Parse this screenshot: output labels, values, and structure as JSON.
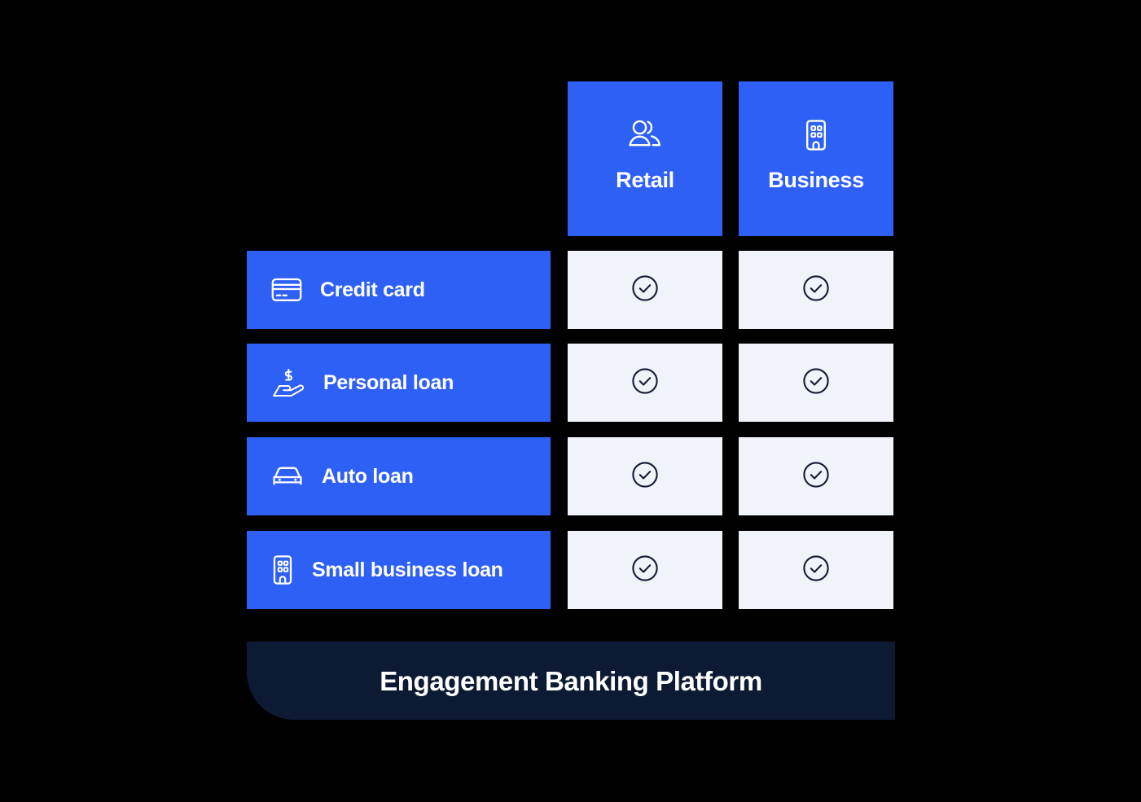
{
  "theme": {
    "background": "#000000",
    "accent_blue": "#2f60f5",
    "cell_light": "#f0f3fa",
    "footer_navy": "#0c1b33",
    "text_white": "#ffffff",
    "check_navy": "#131c34"
  },
  "matrix": {
    "columns": [
      {
        "label": "Retail",
        "icon": "users-icon"
      },
      {
        "label": "Business",
        "icon": "building-icon"
      }
    ],
    "rows": [
      {
        "label": "Credit card",
        "icon": "credit-card-icon",
        "cells": [
          {
            "state": "included",
            "icon": "check-circle-icon"
          },
          {
            "state": "included",
            "icon": "check-circle-icon"
          }
        ]
      },
      {
        "label": "Personal loan",
        "icon": "hand-dollar-icon",
        "cells": [
          {
            "state": "included",
            "icon": "check-circle-icon"
          },
          {
            "state": "included",
            "icon": "check-circle-icon"
          }
        ]
      },
      {
        "label": "Auto loan",
        "icon": "car-icon",
        "cells": [
          {
            "state": "included",
            "icon": "check-circle-icon"
          },
          {
            "state": "included",
            "icon": "check-circle-icon"
          }
        ]
      },
      {
        "label": "Small business loan",
        "icon": "building-icon",
        "cells": [
          {
            "state": "included",
            "icon": "check-circle-icon"
          },
          {
            "state": "included",
            "icon": "check-circle-icon"
          }
        ]
      }
    ]
  },
  "footer": {
    "label": "Engagement Banking Platform"
  }
}
